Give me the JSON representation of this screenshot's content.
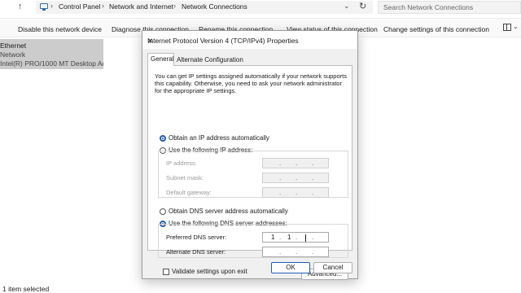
{
  "explorer": {
    "breadcrumbs": [
      "Control Panel",
      "Network and Internet",
      "Network Connections"
    ],
    "search_placeholder": "Search Network Connections",
    "commands": [
      "Disable this network device",
      "Diagnose this connection",
      "Rename this connection",
      "View status of this connection",
      "Change settings of this connection"
    ],
    "adapter": {
      "name": "Ethernet",
      "network": "Network",
      "device": "Intel(R) PRO/1000 MT Desktop Ad..."
    },
    "status": "1 item selected"
  },
  "dialog": {
    "title": "Internet Protocol Version 4 (TCP/IPv4) Properties",
    "tabs": [
      "General",
      "Alternate Configuration"
    ],
    "intro": "You can get IP settings assigned automatically if your network supports this capability. Otherwise, you need to ask your network administrator for the appropriate IP settings.",
    "ip_auto_label": "Obtain an IP address automatically",
    "ip_manual_label": "Use the following IP address:",
    "ip_fields": [
      {
        "label": "IP address:",
        "value": ""
      },
      {
        "label": "Subnet mask:",
        "value": ""
      },
      {
        "label": "Default gateway:",
        "value": ""
      }
    ],
    "dns_auto_label": "Obtain DNS server address automatically",
    "dns_manual_label": "Use the following DNS server addresses:",
    "dns_fields": [
      {
        "label": "Preferred DNS server:",
        "octets": [
          "1",
          "1",
          "",
          ""
        ]
      },
      {
        "label": "Alternate DNS server:",
        "octets": [
          "",
          "",
          "",
          ""
        ]
      }
    ],
    "validate_label": "Validate settings upon exit",
    "advanced_label": "Advanced...",
    "ok_label": "OK",
    "cancel_label": "Cancel",
    "selected": {
      "ip_mode": "auto",
      "dns_mode": "manual",
      "validate": false
    }
  }
}
